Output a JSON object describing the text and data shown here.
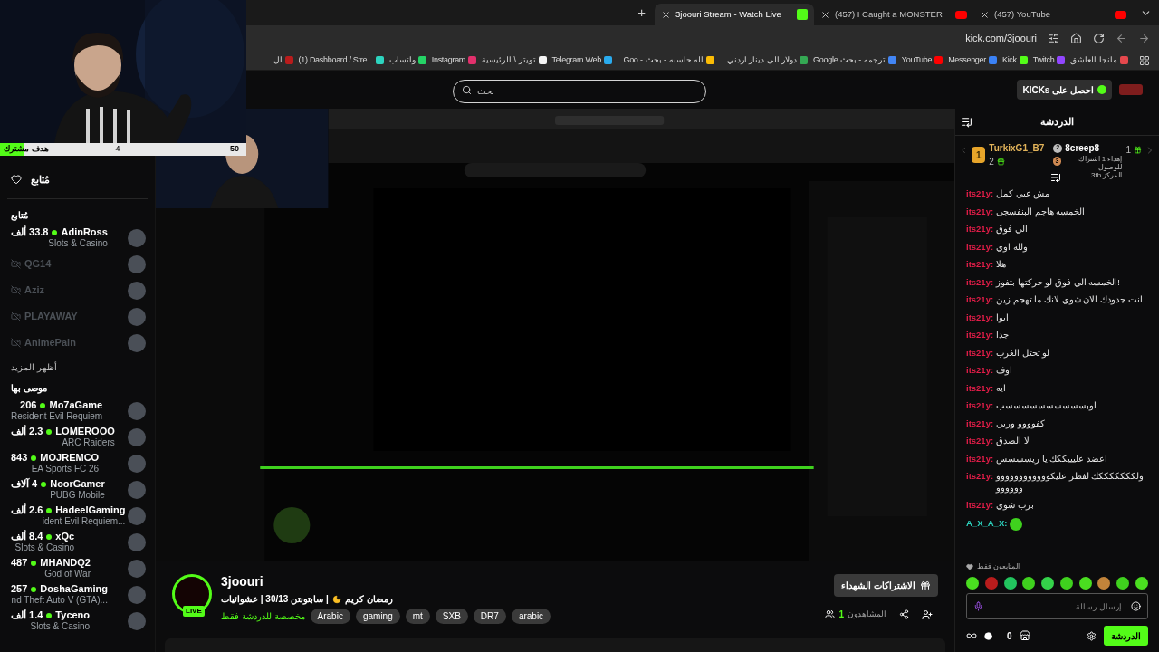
{
  "browser": {
    "new_tab": "+",
    "tabs": [
      {
        "title": "(457) YouTube",
        "selected": false,
        "kind": "youtube"
      },
      {
        "title": "(457) I Caught a MONSTER",
        "selected": false,
        "kind": "youtube"
      },
      {
        "title": "3joouri Stream - Watch Live",
        "selected": true,
        "kind": "kick"
      }
    ],
    "url": "kick.com/3joouri",
    "bookmarks": [
      {
        "label": "مانجا العاشق",
        "color": "#e5484d"
      },
      {
        "label": "Twitch",
        "color": "#9146ff"
      },
      {
        "label": "Kick",
        "color": "#53fc18"
      },
      {
        "label": "Messenger",
        "color": "#3b82f6"
      },
      {
        "label": "YouTube",
        "color": "#ff0000"
      },
      {
        "label": "ترجمه - بحث Google",
        "color": "#4285f4"
      },
      {
        "label": "دولار الى دينار اردني...",
        "color": "#34a853"
      },
      {
        "label": "اله حاسبه - بحث - Goo...",
        "color": "#fbbc05"
      },
      {
        "label": "Telegram Web",
        "color": "#2aabee"
      },
      {
        "label": "تويتر \\ الرئيسية",
        "color": "#f5f5f5"
      },
      {
        "label": "Instagram",
        "color": "#e1306c"
      },
      {
        "label": "واتساب",
        "color": "#25d366"
      },
      {
        "label": "(1) Dashboard / Stre...",
        "color": "#2dd4bf"
      },
      {
        "label": "ال",
        "color": "#b91c1c"
      }
    ]
  },
  "header": {
    "search": {
      "placeholder": "بحث"
    },
    "kicks_button": "احصل على KICKs"
  },
  "overlay": {
    "goal_label": "هدف مشترك",
    "goal_current": "4",
    "goal_target": "50",
    "level": 0.1
  },
  "sidebar": {
    "follow_button": "مُتابع",
    "following_title": "مُتابع",
    "following": [
      {
        "name": "AdinRoss",
        "live": true,
        "viewers": "33.8 ألف",
        "category": "Slots & Casino"
      },
      {
        "name": "QG14",
        "live": false
      },
      {
        "name": "Aziz",
        "live": false
      },
      {
        "name": "PLAYAWAY",
        "live": false
      },
      {
        "name": "AnimePain",
        "live": false
      }
    ],
    "show_more": "أظهر المزيد",
    "recommended_title": "موصى بها",
    "recommended": [
      {
        "name": "Mo7aGame",
        "live": true,
        "viewers": "206",
        "category": "Resident Evil Requiem"
      },
      {
        "name": "LOMEROOO",
        "live": true,
        "viewers": "2.3 ألف",
        "category": "ARC Raiders"
      },
      {
        "name": "MOJREMCO",
        "live": true,
        "viewers": "843",
        "category": "EA Sports FC 26"
      },
      {
        "name": "NoorGamer",
        "live": true,
        "viewers": "4 آلاف",
        "category": "PUBG Mobile"
      },
      {
        "name": "HadeelGaming",
        "live": true,
        "viewers": "2.6 ألف",
        "category": "...ident Evil Requiem"
      },
      {
        "name": "xQc",
        "live": true,
        "viewers": "8.4 ألف",
        "category": "Slots & Casino"
      },
      {
        "name": "MHANDQ2",
        "live": true,
        "viewers": "487",
        "category": "God of War"
      },
      {
        "name": "DoshaGaming",
        "live": true,
        "viewers": "257",
        "category": "...nd Theft Auto V (GTA)"
      },
      {
        "name": "Tyceno",
        "live": true,
        "viewers": "1.4 ألف",
        "category": "Slots & Casino"
      }
    ]
  },
  "stream": {
    "live_badge": "LIVE",
    "channel": "3joouri",
    "title_start": "رمضان كريم",
    "title_end": "| سابتونتن 30/13 | عشوائيات",
    "chat_note": "مخصصة للدردشة فقط",
    "tags": [
      "arabic",
      "DR7",
      "SXB",
      "mt",
      "gaming",
      "Arabic"
    ],
    "subs_button": "الاشتراكات الشهداء",
    "viewers_label": "المشاهدون",
    "viewers_count": "1"
  },
  "chat": {
    "title": "الدردشة",
    "leaders": {
      "first": {
        "rank": "1",
        "name": "TurkixG1_B7",
        "gifts": "2"
      },
      "second": {
        "rank": "2",
        "name": "8creep8",
        "gifts": "1"
      },
      "hint": {
        "rank": "3",
        "line1": "إهداء 1 اشتراك للوصول",
        "line2": "المركز 3th"
      }
    },
    "messages": [
      {
        "user": "its21y:",
        "text": "مش عبي كمل",
        "color": "#e11d48"
      },
      {
        "user": "its21y:",
        "text": "الخمسه هاجم البنفسجي",
        "color": "#e11d48"
      },
      {
        "user": "its21y:",
        "text": "الي فوق",
        "color": "#e11d48"
      },
      {
        "user": "its21y:",
        "text": "ولله اوي",
        "color": "#e11d48"
      },
      {
        "user": "its21y:",
        "text": "هلا",
        "color": "#e11d48"
      },
      {
        "user": "its21y:",
        "text": "الخمسه الي فوق لو حركتها بتفوز!",
        "color": "#e11d48"
      },
      {
        "user": "its21y:",
        "text": "انت جدودك الان شوي لانك ما تهجم زين",
        "color": "#e11d48"
      },
      {
        "user": "its21y:",
        "text": "ايوا",
        "color": "#e11d48"
      },
      {
        "user": "its21y:",
        "text": "جدا",
        "color": "#e11d48"
      },
      {
        "user": "its21y:",
        "text": "لو تحتل الغرب",
        "color": "#e11d48"
      },
      {
        "user": "its21y:",
        "text": "اوف",
        "color": "#e11d48"
      },
      {
        "user": "its21y:",
        "text": "ايه",
        "color": "#e11d48"
      },
      {
        "user": "its21y:",
        "text": "اوبسسسسسسسسسسب",
        "color": "#e11d48"
      },
      {
        "user": "its21y:",
        "text": "كفوووو وربي",
        "color": "#e11d48"
      },
      {
        "user": "its21y:",
        "text": "لا الصدق",
        "color": "#e11d48"
      },
      {
        "user": "its21y:",
        "text": "اعضد عليييككك يا ريسسسس",
        "color": "#e11d48"
      },
      {
        "user": "its21y:",
        "text": "ولكككككككك لفطر عليكوووووووووووووووووو",
        "color": "#e11d48"
      },
      {
        "user": "its21y:",
        "text": "برب شوي",
        "color": "#e11d48"
      },
      {
        "user": "A_X_A_X:",
        "kind": "emote",
        "color": "#2dd4bf"
      }
    ],
    "followers_only": "المتابعون فقط",
    "input": {
      "placeholder": "إرسال رسالة"
    },
    "points": "0",
    "chat_button": "الدردشة"
  }
}
